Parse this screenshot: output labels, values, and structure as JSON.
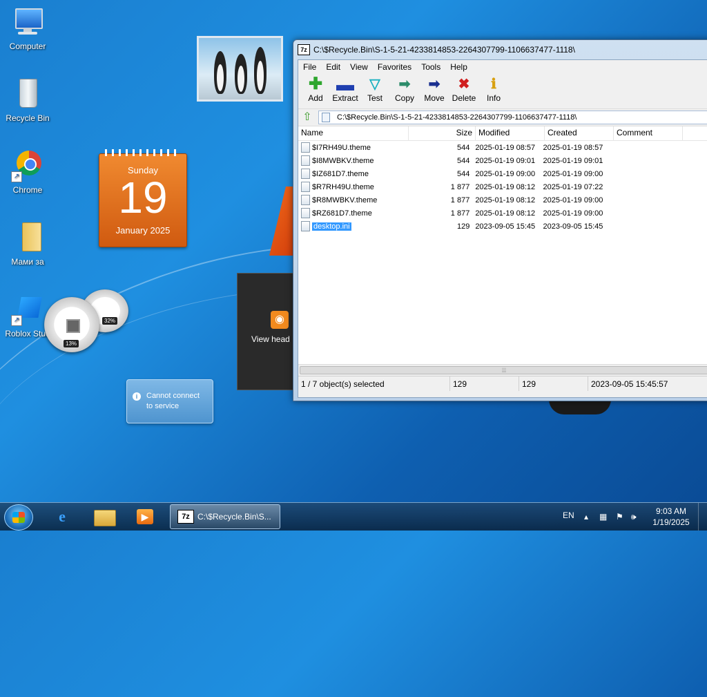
{
  "desktop": {
    "icons": [
      {
        "label": "Computer"
      },
      {
        "label": "Recycle Bin"
      },
      {
        "label": "Chrome"
      },
      {
        "label": "Мами за"
      },
      {
        "label": "Roblox Stud"
      }
    ]
  },
  "calendar": {
    "weekday": "Sunday",
    "day": "19",
    "month_year": "January 2025"
  },
  "meters": {
    "cpu": "13%",
    "mem": "32%"
  },
  "rss": {
    "text": "View head"
  },
  "weather": {
    "line1": "Cannot connect",
    "line2": "to service"
  },
  "window": {
    "title": "C:\\$Recycle.Bin\\S-1-5-21-4233814853-2264307799-1106637477-1118\\",
    "app_icon": "7z",
    "menu": [
      "File",
      "Edit",
      "View",
      "Favorites",
      "Tools",
      "Help"
    ],
    "toolbar": [
      {
        "label": "Add",
        "icon": "plus-icon",
        "color": "#2ea62e"
      },
      {
        "label": "Extract",
        "icon": "minus-icon",
        "color": "#1f3fb0"
      },
      {
        "label": "Test",
        "icon": "check-icon",
        "color": "#1ab0c0"
      },
      {
        "label": "Copy",
        "icon": "arrow-right-icon",
        "color": "#2c8c6a"
      },
      {
        "label": "Move",
        "icon": "arrow-right-icon",
        "color": "#1a2f90"
      },
      {
        "label": "Delete",
        "icon": "x-icon",
        "color": "#d02020"
      },
      {
        "label": "Info",
        "icon": "info-icon",
        "color": "#d8a010"
      }
    ],
    "address": "C:\\$Recycle.Bin\\S-1-5-21-4233814853-2264307799-1106637477-1118\\",
    "columns": [
      "Name",
      "Size",
      "Modified",
      "Created",
      "Comment"
    ],
    "rows": [
      {
        "name": "$I7RH49U.theme",
        "size": "544",
        "modified": "2025-01-19 08:57",
        "created": "2025-01-19 08:57",
        "comment": ""
      },
      {
        "name": "$I8MWBKV.theme",
        "size": "544",
        "modified": "2025-01-19 09:01",
        "created": "2025-01-19 09:01",
        "comment": ""
      },
      {
        "name": "$IZ681D7.theme",
        "size": "544",
        "modified": "2025-01-19 09:00",
        "created": "2025-01-19 09:00",
        "comment": ""
      },
      {
        "name": "$R7RH49U.theme",
        "size": "1 877",
        "modified": "2025-01-19 08:12",
        "created": "2025-01-19 07:22",
        "comment": ""
      },
      {
        "name": "$R8MWBKV.theme",
        "size": "1 877",
        "modified": "2025-01-19 08:12",
        "created": "2025-01-19 09:00",
        "comment": ""
      },
      {
        "name": "$RZ681D7.theme",
        "size": "1 877",
        "modified": "2025-01-19 08:12",
        "created": "2025-01-19 09:00",
        "comment": ""
      },
      {
        "name": "desktop.ini",
        "size": "129",
        "modified": "2023-09-05 15:45",
        "created": "2023-09-05 15:45",
        "comment": ""
      }
    ],
    "selected_row": 6,
    "status": {
      "selection": "1 / 7 object(s) selected",
      "size": "129",
      "packed": "129",
      "date": "2023-09-05 15:45:57"
    }
  },
  "taskbar": {
    "task_label": "C:\\$Recycle.Bin\\S...",
    "lang": "EN",
    "time": "9:03 AM",
    "date": "1/19/2025"
  }
}
